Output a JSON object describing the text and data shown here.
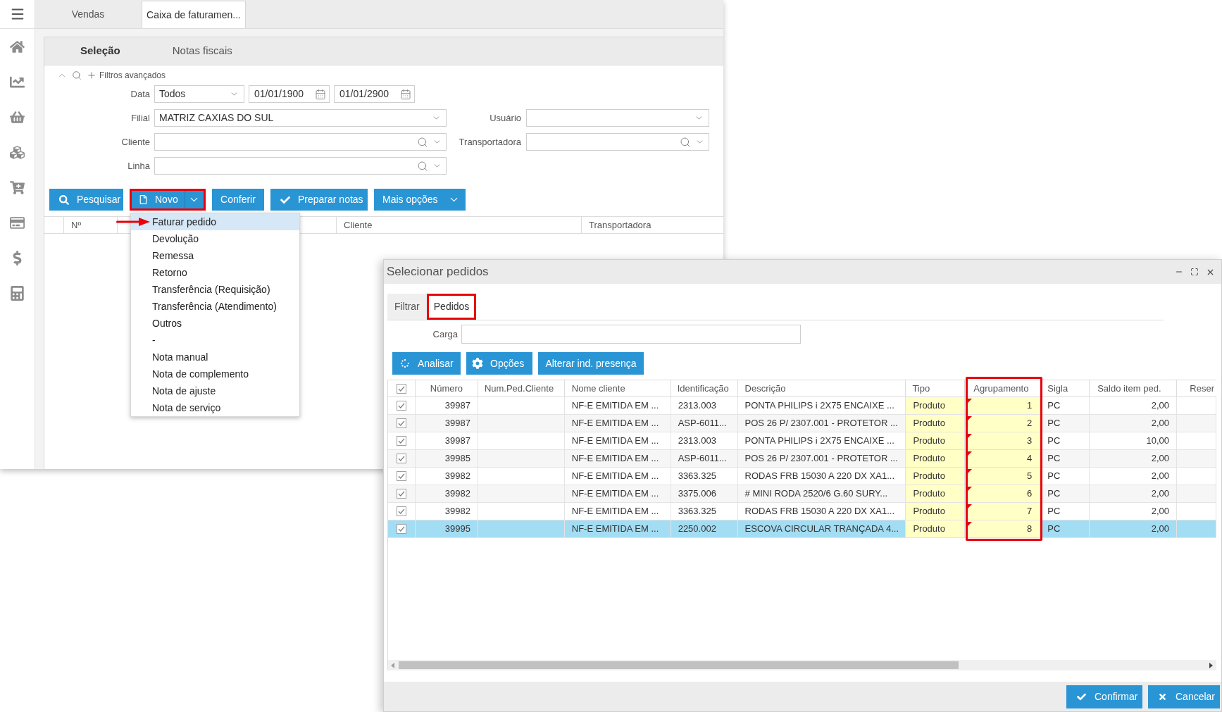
{
  "main_window": {
    "tabs": [
      {
        "label": "Vendas",
        "selected": false
      },
      {
        "label": "Caixa de faturamen...",
        "selected": true
      }
    ],
    "panel_tabs": [
      {
        "label": "Seleção",
        "selected": true
      },
      {
        "label": "Notas fiscais",
        "selected": false
      }
    ],
    "filters": {
      "title": "Filtros avançados",
      "rows": [
        {
          "label": "Data",
          "controls": [
            {
              "kind": "select",
              "value": "Todos"
            },
            {
              "kind": "date",
              "value": "01/01/1900"
            },
            {
              "kind": "date",
              "value": "01/01/2900"
            }
          ]
        },
        {
          "label": "Filial",
          "controls": [
            {
              "kind": "select",
              "value": "MATRIZ CAXIAS DO SUL"
            }
          ],
          "side": {
            "label": "Usuário",
            "kind": "select"
          }
        },
        {
          "label": "Cliente",
          "controls": [
            {
              "kind": "lookup"
            }
          ],
          "side": {
            "label": "Transportadora",
            "kind": "lookup"
          }
        },
        {
          "label": "Linha",
          "controls": [
            {
              "kind": "lookup"
            }
          ]
        }
      ]
    },
    "buttons": [
      {
        "label": "Pesquisar",
        "kind": "button",
        "highlighted": false
      },
      {
        "label": "Novo",
        "kind": "split",
        "highlighted": true
      },
      {
        "label": "Conferir",
        "kind": "button",
        "highlighted": false
      },
      {
        "label": "Preparar notas",
        "kind": "button",
        "highlighted": false
      },
      {
        "label": "Mais opções",
        "kind": "dropdown",
        "highlighted": false
      }
    ],
    "grid": {
      "columns": [
        {
          "label": "Nº"
        },
        {
          "label": "Cliente"
        },
        {
          "label": "Transportadora"
        }
      ]
    },
    "new_menu": {
      "items": [
        {
          "label": "Faturar pedido",
          "selected": true,
          "arrow": true
        },
        {
          "label": "Devolução",
          "selected": false,
          "arrow": false
        },
        {
          "label": "Remessa",
          "selected": false,
          "arrow": false
        },
        {
          "label": "Retorno",
          "selected": false,
          "arrow": false
        },
        {
          "label": "Transferência (Requisição)",
          "selected": false,
          "arrow": false
        },
        {
          "label": "Transferência (Atendimento)",
          "selected": false,
          "arrow": false
        },
        {
          "label": "Outros",
          "selected": false,
          "arrow": false
        },
        {
          "label": "-",
          "selected": false,
          "arrow": false
        },
        {
          "label": "Nota manual",
          "selected": false,
          "arrow": false
        },
        {
          "label": "Nota de complemento",
          "selected": false,
          "arrow": false
        },
        {
          "label": "Nota de ajuste",
          "selected": false,
          "arrow": false
        },
        {
          "label": "Nota de serviço",
          "selected": false,
          "arrow": false
        }
      ]
    }
  },
  "dialog": {
    "title": "Selecionar pedidos",
    "tabs": [
      {
        "label": "Filtrar",
        "selected": false,
        "highlighted": false
      },
      {
        "label": "Pedidos",
        "selected": true,
        "highlighted": true
      }
    ],
    "carga": {
      "label": "Carga"
    },
    "buttons": [
      {
        "label": "Analisar"
      },
      {
        "label": "Opções"
      },
      {
        "label": "Alterar ind. presença"
      }
    ],
    "table": {
      "all_checked": true,
      "columns": [
        {
          "label": "Número",
          "editable": false,
          "highlighted": false
        },
        {
          "label": "Num.Ped.Cliente",
          "editable": false,
          "highlighted": false
        },
        {
          "label": "Nome cliente",
          "editable": false,
          "highlighted": false
        },
        {
          "label": "Identificação",
          "editable": false,
          "highlighted": false
        },
        {
          "label": "Descrição",
          "editable": false,
          "highlighted": false
        },
        {
          "label": "Tipo",
          "editable": true,
          "highlighted": false
        },
        {
          "label": "Agrupamento",
          "editable": true,
          "highlighted": true
        },
        {
          "label": "Sigla",
          "editable": false,
          "highlighted": false
        },
        {
          "label": "Saldo item ped.",
          "editable": false,
          "highlighted": false
        },
        {
          "label": "Reser",
          "editable": false,
          "highlighted": false
        }
      ],
      "rows": [
        {
          "checked": true,
          "selected": false,
          "edited": true,
          "numero": "39987",
          "nome_cliente": "NF-E EMITIDA EM ...",
          "identificacao": "2313.003",
          "descricao": "PONTA PHILIPS i 2X75 ENCAIXE ...",
          "tipo": "Produto",
          "agrupamento": "1",
          "sigla": "PC",
          "saldo_item_ped": "2,00"
        },
        {
          "checked": true,
          "selected": false,
          "edited": true,
          "numero": "39987",
          "nome_cliente": "NF-E EMITIDA EM ...",
          "identificacao": "ASP-6011...",
          "descricao": "POS 26 P/ 2307.001 - PROTETOR ...",
          "tipo": "Produto",
          "agrupamento": "2",
          "sigla": "PC",
          "saldo_item_ped": "2,00"
        },
        {
          "checked": true,
          "selected": false,
          "edited": true,
          "numero": "39987",
          "nome_cliente": "NF-E EMITIDA EM ...",
          "identificacao": "2313.003",
          "descricao": "PONTA PHILIPS i 2X75 ENCAIXE ...",
          "tipo": "Produto",
          "agrupamento": "3",
          "sigla": "PC",
          "saldo_item_ped": "10,00"
        },
        {
          "checked": true,
          "selected": false,
          "edited": true,
          "numero": "39985",
          "nome_cliente": "NF-E EMITIDA EM ...",
          "identificacao": "ASP-6011...",
          "descricao": "POS 26 P/ 2307.001 - PROTETOR ...",
          "tipo": "Produto",
          "agrupamento": "4",
          "sigla": "PC",
          "saldo_item_ped": "2,00"
        },
        {
          "checked": true,
          "selected": false,
          "edited": true,
          "numero": "39982",
          "nome_cliente": "NF-E EMITIDA EM ...",
          "identificacao": "3363.325",
          "descricao": "RODAS FRB 15030 A 220 DX XA1...",
          "tipo": "Produto",
          "agrupamento": "5",
          "sigla": "PC",
          "saldo_item_ped": "2,00"
        },
        {
          "checked": true,
          "selected": false,
          "edited": true,
          "numero": "39982",
          "nome_cliente": "NF-E EMITIDA EM ...",
          "identificacao": "3375.006",
          "descricao": "# MINI RODA 2520/6 G.60 SURY...",
          "tipo": "Produto",
          "agrupamento": "6",
          "sigla": "PC",
          "saldo_item_ped": "2,00"
        },
        {
          "checked": true,
          "selected": false,
          "edited": true,
          "numero": "39982",
          "nome_cliente": "NF-E EMITIDA EM ...",
          "identificacao": "3363.325",
          "descricao": "RODAS FRB 15030 A 220 DX XA1...",
          "tipo": "Produto",
          "agrupamento": "7",
          "sigla": "PC",
          "saldo_item_ped": "2,00"
        },
        {
          "checked": true,
          "selected": true,
          "edited": true,
          "numero": "39995",
          "nome_cliente": "NF-E EMITIDA EM ...",
          "identificacao": "2250.002",
          "descricao": "ESCOVA CIRCULAR TRANÇADA 4...",
          "tipo": "Produto",
          "agrupamento": "8",
          "sigla": "PC",
          "saldo_item_ped": "2,00"
        }
      ]
    },
    "footer_buttons": [
      {
        "label": "Confirmar"
      },
      {
        "label": "Cancelar"
      }
    ]
  }
}
